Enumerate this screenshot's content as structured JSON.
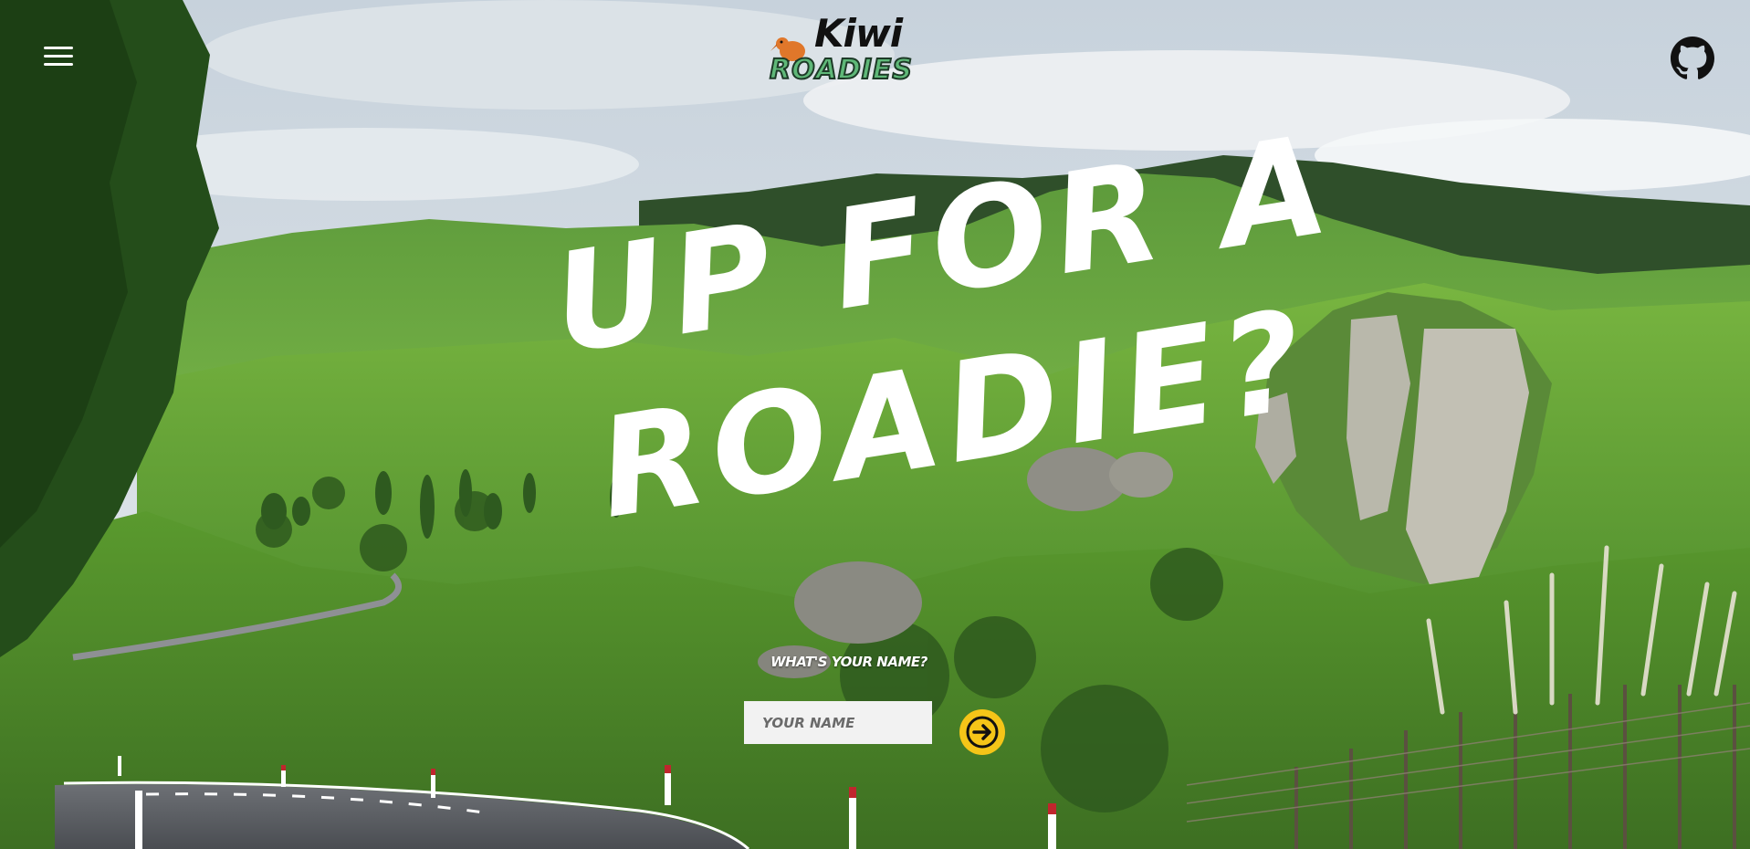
{
  "header": {
    "menu_icon": "hamburger-menu-icon",
    "logo": {
      "top": "Kiwi",
      "bottom": "ROADIES",
      "icon": "kiwi-bird-icon"
    },
    "github_icon": "github-icon"
  },
  "hero": {
    "headline_line1": "UP FOR A",
    "headline_line2": "ROADIE?",
    "background": "new-zealand-green-hills-road-photo"
  },
  "form": {
    "label": "WHAT'S YOUR NAME?",
    "name_placeholder": "YOUR NAME",
    "name_value": "",
    "submit_icon": "arrow-right-icon"
  },
  "colors": {
    "accent_yellow": "#f5c518",
    "logo_green": "#5fb878",
    "headline_white": "#ffffff"
  }
}
